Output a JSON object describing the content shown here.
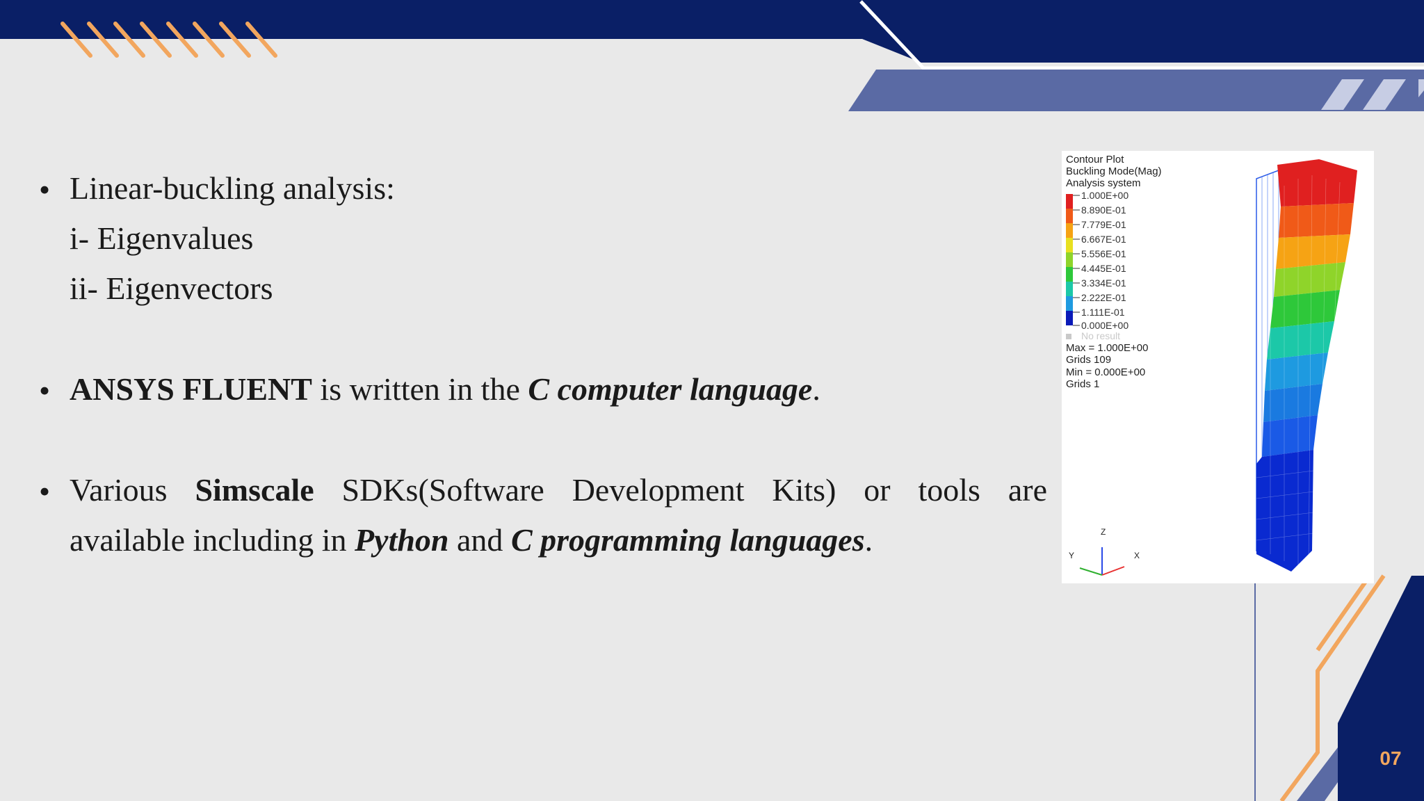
{
  "slide": {
    "bullet_char": "•",
    "bullet1": {
      "title": "Linear-buckling analysis:",
      "sub1": "i-  Eigenvalues",
      "sub2": "ii- Eigenvectors"
    },
    "bullet2": {
      "bold": "ANSYS FLUENT",
      "text": " is written in the ",
      "bold_italic": "C computer language",
      "end": "."
    },
    "bullet3": {
      "t1": "Various ",
      "bold": "Simscale",
      "t2": " SDKs(Software Development Kits) or tools are",
      "t3": "available including in ",
      "bi1": "Python",
      "t4": " and ",
      "bi2": "C programming languages",
      "end": "."
    },
    "page_number": "07"
  },
  "figure": {
    "title_lines": [
      "Contour Plot",
      "Buckling Mode(Mag)",
      "Analysis system"
    ],
    "legend": [
      "1.000E+00",
      "8.890E-01",
      "7.779E-01",
      "6.667E-01",
      "5.556E-01",
      "4.445E-01",
      "3.334E-01",
      "2.222E-01",
      "1.111E-01",
      "0.000E+00"
    ],
    "legend_colors": [
      "#e02020",
      "#f05a18",
      "#f6a314",
      "#e8e020",
      "#8fd42a",
      "#2ec83a",
      "#1cc8a8",
      "#1e9ae0",
      "#1a5ae6",
      "#0a1ab8"
    ],
    "no_result": "No result",
    "stats": [
      "Max = 1.000E+00",
      "Grids 109",
      "Min = 0.000E+00",
      "Grids 1"
    ],
    "axes": {
      "z": "Z",
      "y": "Y",
      "x": "X"
    }
  },
  "colors": {
    "navy": "#0a1f66",
    "light_navy": "#5a6aa4",
    "orange": "#f2a65e",
    "background": "#e9e9e9"
  }
}
